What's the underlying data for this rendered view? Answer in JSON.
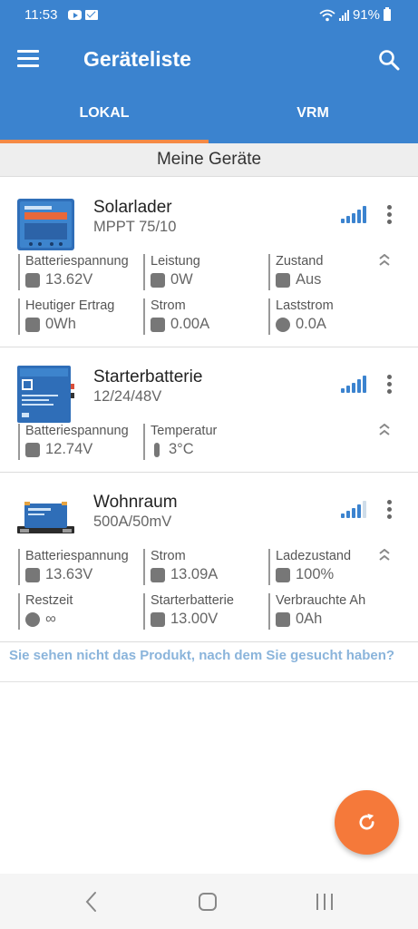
{
  "status_bar": {
    "time": "11:53",
    "battery": "91%"
  },
  "app_bar": {
    "title": "Geräteliste"
  },
  "tabs": [
    {
      "label": "LOKAL",
      "selected": true
    },
    {
      "label": "VRM",
      "selected": false
    }
  ],
  "section_title": "Meine Geräte",
  "devices": [
    {
      "name": "Solarlader",
      "subtitle": "MPPT 75/10",
      "signal_bars": 5,
      "fields": [
        {
          "label": "Batteriespannung",
          "value": "13.62V",
          "icon": "battery-icon"
        },
        {
          "label": "Leistung",
          "value": "0W",
          "icon": "power-icon"
        },
        {
          "label": "Zustand",
          "value": "Aus",
          "icon": "state-icon"
        },
        {
          "label": "Heutiger Ertrag",
          "value": "0Wh",
          "icon": "yield-icon"
        },
        {
          "label": "Strom",
          "value": "0.00A",
          "icon": "current-icon"
        },
        {
          "label": "Laststrom",
          "value": "0.0A",
          "icon": "load-icon"
        }
      ]
    },
    {
      "name": "Starterbatterie",
      "subtitle": "12/24/48V",
      "signal_bars": 5,
      "fields": [
        {
          "label": "Batteriespannung",
          "value": "12.74V",
          "icon": "battery-icon"
        },
        {
          "label": "Temperatur",
          "value": "3°C",
          "icon": "thermometer-icon"
        }
      ]
    },
    {
      "name": "Wohnraum",
      "subtitle": "500A/50mV",
      "signal_bars": 4,
      "fields": [
        {
          "label": "Batteriespannung",
          "value": "13.63V",
          "icon": "battery-icon"
        },
        {
          "label": "Strom",
          "value": "13.09A",
          "icon": "current-icon"
        },
        {
          "label": "Ladezustand",
          "value": "100%",
          "icon": "soc-icon"
        },
        {
          "label": "Restzeit",
          "value": "∞",
          "icon": "clock-icon"
        },
        {
          "label": "Starterbatterie",
          "value": "13.00V",
          "icon": "starter-icon"
        },
        {
          "label": "Verbrauchte Ah",
          "value": "0Ah",
          "icon": "consumed-icon"
        }
      ]
    }
  ],
  "not_found_text": "Sie sehen nicht das Produkt, nach dem Sie gesucht haben?",
  "colors": {
    "primary": "#3b83cf",
    "accent": "#f5793a",
    "signal_active": "#3b83cf",
    "signal_inactive": "#cfdde9"
  }
}
